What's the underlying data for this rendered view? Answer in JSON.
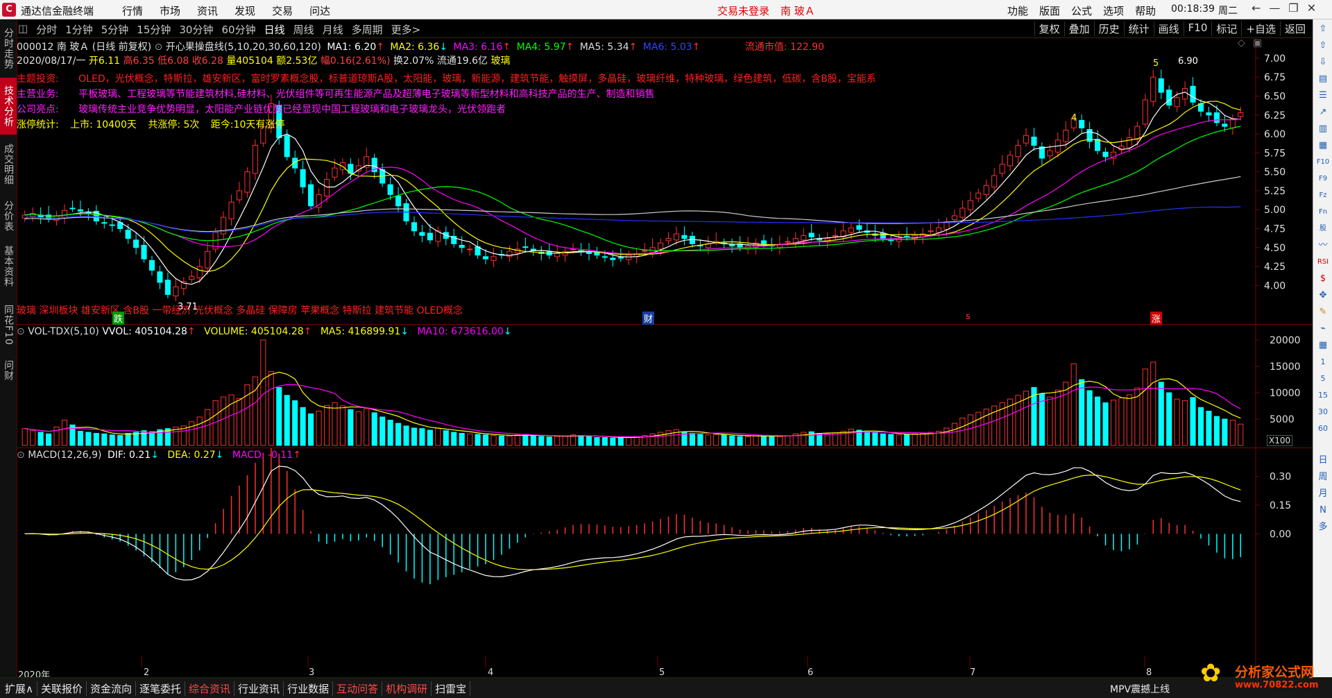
{
  "titlebar": {
    "app_title": "通达信金融终端",
    "menu": [
      "行情",
      "市场",
      "资讯",
      "发现",
      "交易",
      "问达"
    ],
    "trade_status": "交易未登录",
    "stock_name": "南 玻Ａ",
    "right_menu": [
      "功能",
      "版面",
      "公式",
      "选项",
      "帮助"
    ],
    "clock": "00:18:39",
    "weekday": "周二"
  },
  "left_tabs": [
    "分时走势",
    "技术分析",
    "成交明细",
    "分价表",
    "基本资料",
    "同花F10",
    "问财"
  ],
  "left_tabs_active": "技术分析",
  "periods": [
    "分时",
    "1分钟",
    "5分钟",
    "15分钟",
    "30分钟",
    "60分钟",
    "日线",
    "周线",
    "月线",
    "多周期",
    "更多>"
  ],
  "period_active": "日线",
  "toolbar_right": [
    "复权",
    "叠加",
    "历史",
    "统计",
    "画线",
    "F10",
    "标记",
    "+自选",
    "返回"
  ],
  "stock": {
    "code_name": "000012 南 玻Ａ (日线 前复权)",
    "indicator": "开心果操盘线(5,10,20,30,60,120)",
    "ma": [
      {
        "label": "MA1: 6.20",
        "color": "#ffffff"
      },
      {
        "label": "MA2: 6.36",
        "color": "#ffff00"
      },
      {
        "label": "MA3: 6.16",
        "color": "#ff00ff"
      },
      {
        "label": "MA4: 5.97",
        "color": "#00ff00"
      },
      {
        "label": "MA5: 5.34",
        "color": "#dddddd"
      },
      {
        "label": "MA6: 5.03",
        "color": "#2233ff"
      }
    ],
    "float_cap": "流通市值: 122.90",
    "date_line": "2020/08/17/一",
    "open": "开6.11",
    "high": "高6.35",
    "low": "低6.08",
    "close": "收6.28",
    "volume": "量405104",
    "amount": "额2.53亿",
    "change": "幅0.16(2.61%)",
    "turnover": "换2.07%",
    "float_shares": "流通19.6亿",
    "sector": "玻璃"
  },
  "profile": [
    {
      "label": "主题投资:",
      "text": "OLED，光伏概念，特斯拉，雄安新区，富时罗素概念股，标普道琼斯A股，太阳能，玻璃，新能源，建筑节能，触摸屏，多晶硅，玻璃纤维，特种玻璃，绿色建筑，低碳，含B股，宝能系",
      "color": "#ff2020"
    },
    {
      "label": "主营业务:",
      "text": "平板玻璃、工程玻璃等节能建筑材料,硅材料、光伏组件等可再生能源产品及超薄电子玻璃等新型材料和高科技产品的生产、制造和销售",
      "color": "#ff20ff"
    },
    {
      "label": "公司亮点:",
      "text": "玻璃传统主业竞争优势明显，太阳能产业链优势已经显现中国工程玻璃和电子玻璃龙头，光伏领跑者",
      "color": "#ff20ff"
    }
  ],
  "limit_stats": {
    "label": "涨停统计:",
    "listed": "上市: 10400天",
    "count": "共涨停: 5次",
    "recent": "距今:10天有涨停"
  },
  "concepts": "玻璃 深圳板块 雄安新区 含B股 一带经济 光伏概念 多晶硅 保障房 苹果概念 特斯拉 建筑节能 OLED概念",
  "price_markers": {
    "low": "3.71",
    "high": "6.90",
    "low_tag": "跌",
    "finance_tag": "财",
    "s_tag": "s",
    "up_tag": "涨",
    "wave4": "4",
    "wave5": "5"
  },
  "volume_panel": {
    "title": "VOL-TDX(5,10)",
    "vvol": "VVOL: 405104.28",
    "volume": "VOLUME: 405104.28",
    "ma5": "MA5: 416899.91",
    "ma10": "MA10: 673616.00",
    "unit": "X100"
  },
  "macd_panel": {
    "title": "MACD(12,26,9)",
    "dif": "DIF: 0.21",
    "dea": "DEA: 0.27",
    "macd": "MACD: -0.11"
  },
  "x_axis": {
    "year": "2020年",
    "months": [
      "2",
      "3",
      "4",
      "5",
      "6",
      "7",
      "8"
    ]
  },
  "chart_data": [
    {
      "type": "candlestick",
      "title": "000012 南 玻Ａ (日线 前复权)",
      "ylim": [
        3.6,
        7.1
      ],
      "yticks": [
        4.0,
        4.25,
        4.5,
        4.75,
        5.0,
        5.25,
        5.5,
        5.75,
        6.0,
        6.25,
        6.5,
        6.75,
        7.0
      ],
      "closes": [
        4.93,
        4.95,
        4.9,
        4.88,
        4.92,
        4.99,
        5.02,
        4.98,
        4.95,
        4.85,
        4.82,
        4.8,
        4.75,
        4.62,
        4.5,
        4.35,
        4.2,
        4.04,
        3.88,
        3.98,
        4.05,
        4.12,
        4.25,
        4.45,
        4.7,
        4.9,
        5.1,
        5.25,
        5.5,
        5.85,
        6.1,
        6.4,
        5.95,
        5.7,
        5.55,
        5.3,
        5.05,
        5.2,
        5.4,
        5.55,
        5.62,
        5.48,
        5.58,
        5.7,
        5.5,
        5.35,
        5.2,
        5.05,
        4.85,
        4.72,
        4.66,
        4.6,
        4.72,
        4.62,
        4.55,
        4.5,
        4.48,
        4.4,
        4.35,
        4.38,
        4.4,
        4.45,
        4.48,
        4.5,
        4.46,
        4.42,
        4.4,
        4.42,
        4.45,
        4.48,
        4.46,
        4.42,
        4.4,
        4.38,
        4.34,
        4.36,
        4.4,
        4.42,
        4.46,
        4.5,
        4.56,
        4.62,
        4.68,
        4.62,
        4.55,
        4.52,
        4.55,
        4.58,
        4.56,
        4.52,
        4.5,
        4.52,
        4.56,
        4.55,
        4.52,
        4.54,
        4.58,
        4.62,
        4.66,
        4.64,
        4.6,
        4.62,
        4.66,
        4.72,
        4.76,
        4.74,
        4.7,
        4.66,
        4.62,
        4.6,
        4.62,
        4.64,
        4.66,
        4.68,
        4.72,
        4.76,
        4.84,
        4.92,
        5.02,
        5.12,
        5.22,
        5.32,
        5.45,
        5.6,
        5.72,
        5.85,
        5.98,
        5.85,
        5.68,
        5.78,
        5.92,
        6.05,
        6.2,
        6.08,
        5.9,
        5.78,
        5.7,
        5.76,
        5.84,
        5.95,
        6.1,
        6.45,
        6.75,
        6.55,
        6.38,
        6.48,
        6.6,
        6.42,
        6.3,
        6.25,
        6.15,
        6.1,
        6.2,
        6.28
      ],
      "ma_series": [
        "MA1",
        "MA2",
        "MA3",
        "MA4",
        "MA5",
        "MA6"
      ]
    },
    {
      "type": "bar",
      "title": "VOL-TDX(5,10)",
      "ylim": [
        0,
        20000
      ],
      "yticks": [
        5000,
        10000,
        15000,
        20000
      ],
      "values": [
        3200,
        2800,
        2500,
        2200,
        3500,
        4800,
        3900,
        2700,
        2500,
        2300,
        2200,
        2000,
        1900,
        2300,
        2500,
        2800,
        2600,
        3000,
        3200,
        3500,
        3700,
        4500,
        5400,
        6800,
        8500,
        9200,
        9600,
        8900,
        11500,
        13000,
        20000,
        14000,
        11000,
        9500,
        8500,
        7200,
        6000,
        6500,
        7600,
        8100,
        7500,
        6800,
        6400,
        7000,
        6200,
        5400,
        4800,
        4200,
        3700,
        3300,
        3200,
        2900,
        3300,
        2800,
        2500,
        2300,
        2200,
        2100,
        2000,
        1900,
        1800,
        1800,
        2000,
        2100,
        1900,
        1700,
        1600,
        1700,
        1800,
        2000,
        1900,
        1700,
        1500,
        1500,
        1400,
        1500,
        1600,
        1700,
        1900,
        2200,
        2500,
        2800,
        3000,
        2600,
        2300,
        2100,
        2000,
        2100,
        2000,
        1800,
        1700,
        1700,
        1800,
        1900,
        1800,
        1700,
        1800,
        2200,
        2500,
        2600,
        2300,
        2200,
        2400,
        2700,
        3100,
        2900,
        2600,
        2400,
        2200,
        2100,
        2000,
        2100,
        2200,
        2300,
        2500,
        2700,
        3300,
        4200,
        5200,
        5800,
        6300,
        6900,
        7500,
        8100,
        8800,
        9500,
        10300,
        11000,
        9800,
        9200,
        10500,
        12000,
        15500,
        12500,
        10400,
        9200,
        8100,
        8600,
        9000,
        9600,
        10900,
        14500,
        15800,
        12000,
        10000,
        8800,
        8500,
        9100,
        7200,
        6500,
        5500,
        5000,
        4800,
        4051
      ],
      "ma_series": [
        "MA5",
        "MA10"
      ]
    },
    {
      "type": "bar",
      "title": "MACD(12,26,9)",
      "ylim": [
        -0.06,
        0.36
      ],
      "yticks": [
        0.0,
        0.15,
        0.3
      ],
      "series": [
        {
          "name": "DIF",
          "color": "#ffffff"
        },
        {
          "name": "DEA",
          "color": "#ffff00"
        },
        {
          "name": "MACD",
          "color": "#ff00ff"
        }
      ]
    }
  ]
}
